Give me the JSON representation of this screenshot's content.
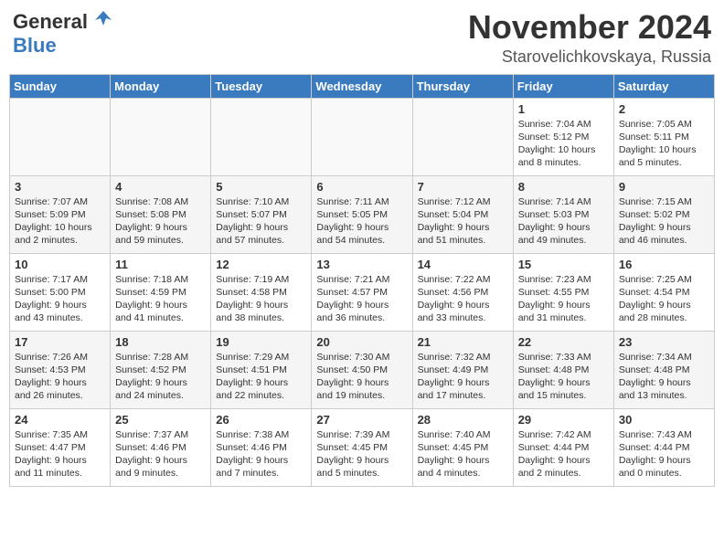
{
  "header": {
    "logo_general": "General",
    "logo_blue": "Blue",
    "month_title": "November 2024",
    "location": "Starovelichkovskaya, Russia"
  },
  "days_of_week": [
    "Sunday",
    "Monday",
    "Tuesday",
    "Wednesday",
    "Thursday",
    "Friday",
    "Saturday"
  ],
  "weeks": [
    [
      {
        "day": "",
        "info": ""
      },
      {
        "day": "",
        "info": ""
      },
      {
        "day": "",
        "info": ""
      },
      {
        "day": "",
        "info": ""
      },
      {
        "day": "",
        "info": ""
      },
      {
        "day": "1",
        "info": "Sunrise: 7:04 AM\nSunset: 5:12 PM\nDaylight: 10 hours and 8 minutes."
      },
      {
        "day": "2",
        "info": "Sunrise: 7:05 AM\nSunset: 5:11 PM\nDaylight: 10 hours and 5 minutes."
      }
    ],
    [
      {
        "day": "3",
        "info": "Sunrise: 7:07 AM\nSunset: 5:09 PM\nDaylight: 10 hours and 2 minutes."
      },
      {
        "day": "4",
        "info": "Sunrise: 7:08 AM\nSunset: 5:08 PM\nDaylight: 9 hours and 59 minutes."
      },
      {
        "day": "5",
        "info": "Sunrise: 7:10 AM\nSunset: 5:07 PM\nDaylight: 9 hours and 57 minutes."
      },
      {
        "day": "6",
        "info": "Sunrise: 7:11 AM\nSunset: 5:05 PM\nDaylight: 9 hours and 54 minutes."
      },
      {
        "day": "7",
        "info": "Sunrise: 7:12 AM\nSunset: 5:04 PM\nDaylight: 9 hours and 51 minutes."
      },
      {
        "day": "8",
        "info": "Sunrise: 7:14 AM\nSunset: 5:03 PM\nDaylight: 9 hours and 49 minutes."
      },
      {
        "day": "9",
        "info": "Sunrise: 7:15 AM\nSunset: 5:02 PM\nDaylight: 9 hours and 46 minutes."
      }
    ],
    [
      {
        "day": "10",
        "info": "Sunrise: 7:17 AM\nSunset: 5:00 PM\nDaylight: 9 hours and 43 minutes."
      },
      {
        "day": "11",
        "info": "Sunrise: 7:18 AM\nSunset: 4:59 PM\nDaylight: 9 hours and 41 minutes."
      },
      {
        "day": "12",
        "info": "Sunrise: 7:19 AM\nSunset: 4:58 PM\nDaylight: 9 hours and 38 minutes."
      },
      {
        "day": "13",
        "info": "Sunrise: 7:21 AM\nSunset: 4:57 PM\nDaylight: 9 hours and 36 minutes."
      },
      {
        "day": "14",
        "info": "Sunrise: 7:22 AM\nSunset: 4:56 PM\nDaylight: 9 hours and 33 minutes."
      },
      {
        "day": "15",
        "info": "Sunrise: 7:23 AM\nSunset: 4:55 PM\nDaylight: 9 hours and 31 minutes."
      },
      {
        "day": "16",
        "info": "Sunrise: 7:25 AM\nSunset: 4:54 PM\nDaylight: 9 hours and 28 minutes."
      }
    ],
    [
      {
        "day": "17",
        "info": "Sunrise: 7:26 AM\nSunset: 4:53 PM\nDaylight: 9 hours and 26 minutes."
      },
      {
        "day": "18",
        "info": "Sunrise: 7:28 AM\nSunset: 4:52 PM\nDaylight: 9 hours and 24 minutes."
      },
      {
        "day": "19",
        "info": "Sunrise: 7:29 AM\nSunset: 4:51 PM\nDaylight: 9 hours and 22 minutes."
      },
      {
        "day": "20",
        "info": "Sunrise: 7:30 AM\nSunset: 4:50 PM\nDaylight: 9 hours and 19 minutes."
      },
      {
        "day": "21",
        "info": "Sunrise: 7:32 AM\nSunset: 4:49 PM\nDaylight: 9 hours and 17 minutes."
      },
      {
        "day": "22",
        "info": "Sunrise: 7:33 AM\nSunset: 4:48 PM\nDaylight: 9 hours and 15 minutes."
      },
      {
        "day": "23",
        "info": "Sunrise: 7:34 AM\nSunset: 4:48 PM\nDaylight: 9 hours and 13 minutes."
      }
    ],
    [
      {
        "day": "24",
        "info": "Sunrise: 7:35 AM\nSunset: 4:47 PM\nDaylight: 9 hours and 11 minutes."
      },
      {
        "day": "25",
        "info": "Sunrise: 7:37 AM\nSunset: 4:46 PM\nDaylight: 9 hours and 9 minutes."
      },
      {
        "day": "26",
        "info": "Sunrise: 7:38 AM\nSunset: 4:46 PM\nDaylight: 9 hours and 7 minutes."
      },
      {
        "day": "27",
        "info": "Sunrise: 7:39 AM\nSunset: 4:45 PM\nDaylight: 9 hours and 5 minutes."
      },
      {
        "day": "28",
        "info": "Sunrise: 7:40 AM\nSunset: 4:45 PM\nDaylight: 9 hours and 4 minutes."
      },
      {
        "day": "29",
        "info": "Sunrise: 7:42 AM\nSunset: 4:44 PM\nDaylight: 9 hours and 2 minutes."
      },
      {
        "day": "30",
        "info": "Sunrise: 7:43 AM\nSunset: 4:44 PM\nDaylight: 9 hours and 0 minutes."
      }
    ]
  ]
}
